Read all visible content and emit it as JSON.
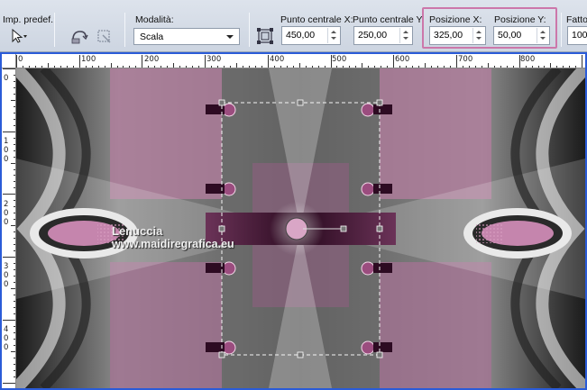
{
  "toolbar": {
    "preset_label": "Imp. predef.:",
    "mode_label": "Modalità:",
    "mode_value": "Scala",
    "center_x_label": "Punto centrale X:",
    "center_x_value": "450,00",
    "center_y_label": "Punto centrale Y:",
    "center_y_value": "250,00",
    "pos_x_label": "Posizione X:",
    "pos_x_value": "325,00",
    "pos_y_label": "Posizione Y:",
    "pos_y_value": "50,00",
    "factor_label": "Fatto",
    "factor_value": "100,"
  },
  "ruler": {
    "h_labels": [
      "0",
      "100",
      "200",
      "300",
      "400",
      "500",
      "600",
      "700",
      "800"
    ],
    "v_labels": [
      [
        "0"
      ],
      [
        "1",
        "0",
        "0"
      ],
      [
        "2",
        "0",
        "0"
      ],
      [
        "3",
        "0",
        "0"
      ],
      [
        "4",
        "0",
        "0"
      ]
    ]
  },
  "canvas": {
    "watermark_line1": "Lenuccia",
    "watermark_line2": "www.maidiregrafica.eu",
    "colors": {
      "pink": "#c585ad",
      "deep_plum": "#3a0f2a",
      "gray": "#8b8b8b",
      "light": "#e6e6e6"
    }
  }
}
